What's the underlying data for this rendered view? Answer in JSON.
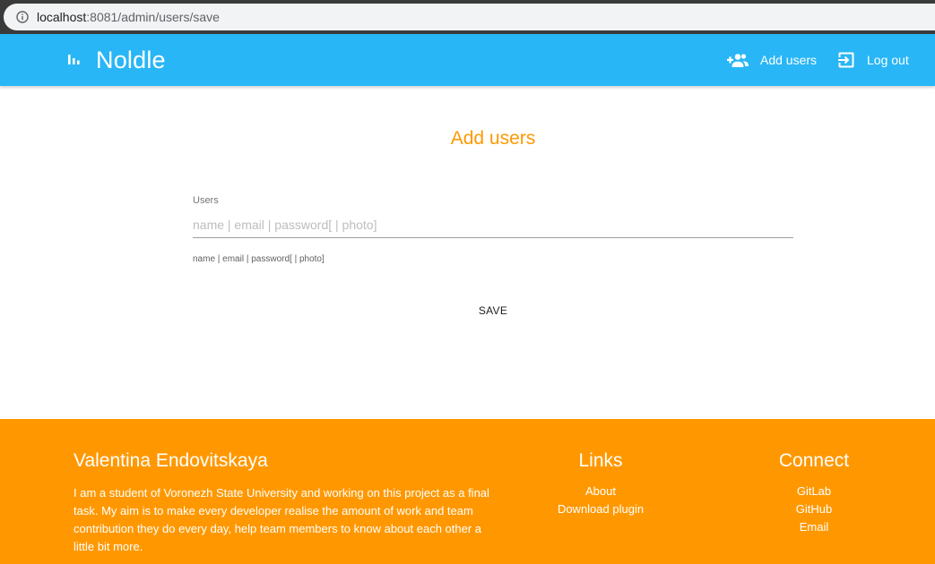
{
  "browser": {
    "url_host": "localhost",
    "url_rest": ":8081/admin/users/save"
  },
  "header": {
    "brand": "Noldle",
    "nav": {
      "add_users": "Add users",
      "log_out": "Log out"
    }
  },
  "main": {
    "title": "Add users",
    "users_field": {
      "label": "Users",
      "value": "",
      "placeholder": "name | email | password[ | photo]",
      "helper": "name | email | password[ | photo]"
    },
    "save_label": "SAVE"
  },
  "footer": {
    "author_name": "Valentina Endovitskaya",
    "bio": "I am a student of Voronezh State University and working on this project as a final task. My aim is to make every developer realise the amount of work and team contribution they do every day, help team members to know about each other a little bit more.",
    "links": {
      "heading": "Links",
      "items": [
        "About",
        "Download plugin"
      ]
    },
    "connect": {
      "heading": "Connect",
      "items": [
        "GitLab",
        "GitHub",
        "Email"
      ]
    }
  },
  "colors": {
    "header_bg": "#29b6f6",
    "accent_orange": "#ff9800"
  },
  "icons": {
    "brand": "bar-chart-icon",
    "add_users": "group-add-icon",
    "log_out": "exit-icon",
    "site_info": "info-icon"
  }
}
